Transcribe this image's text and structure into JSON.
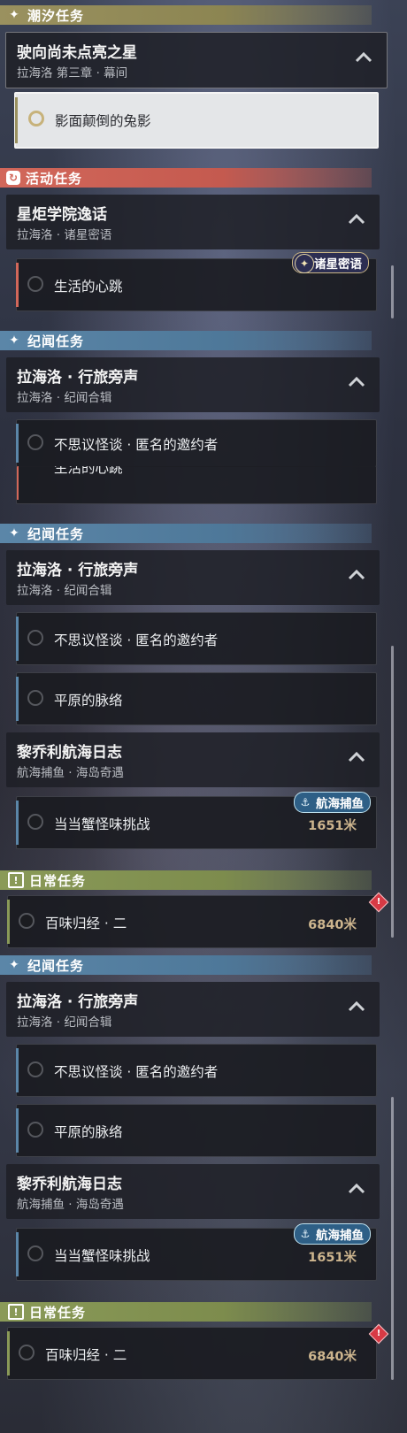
{
  "panel1": {
    "header": {
      "title": "潮汐任务",
      "icon": "sparkle-icon",
      "color": "#9a915f"
    },
    "group": {
      "title": "驶向尚未点亮之星",
      "sub": "拉海洛 第三章 · 幕间"
    },
    "task": {
      "name": "影面颠倒的兔影"
    }
  },
  "panel2": {
    "header": {
      "title": "活动任务",
      "icon": "event-icon",
      "color": "#d2675a"
    },
    "group": {
      "title": "星炬学院逸话",
      "sub": "拉海洛 · 诸星密语"
    },
    "badge": "诸星密语",
    "task": {
      "name": "生活的心跳"
    }
  },
  "panel3": {
    "header": {
      "title": "纪闻任务",
      "icon": "sparkle-icon",
      "color": "#5b86a8"
    },
    "group": {
      "title": "拉海洛 · 行旅旁声",
      "sub": "拉海洛 · 纪闻合辑"
    },
    "task": {
      "name": "不思议怪谈 · 匿名的邀约者"
    },
    "partial_task": "生活的心跳"
  },
  "panel4": {
    "header": {
      "title": "纪闻任务",
      "icon": "sparkle-icon",
      "color": "#5b86a8"
    },
    "group1": {
      "title": "拉海洛 · 行旅旁声",
      "sub": "拉海洛 · 纪闻合辑"
    },
    "task1": {
      "name": "不思议怪谈 · 匿名的邀约者"
    },
    "task2": {
      "name": "平原的脉络"
    },
    "group2": {
      "title": "黎乔利航海日志",
      "sub": "航海捕鱼 · 海岛奇遇"
    },
    "badge": "航海捕鱼",
    "task3": {
      "name": "当当蟹怪味挑战",
      "distance": "1651米"
    },
    "daily_header": {
      "title": "日常任务",
      "icon": "exclamation-icon",
      "color": "#8a9a58"
    },
    "daily": {
      "name": "百味归经 · 二",
      "distance": "6840米",
      "alert": "!"
    }
  },
  "panel5": {
    "header": {
      "title": "纪闻任务",
      "icon": "sparkle-icon",
      "color": "#5b86a8"
    },
    "group1": {
      "title": "拉海洛 · 行旅旁声",
      "sub": "拉海洛 · 纪闻合辑"
    },
    "task1": {
      "name": "不思议怪谈 · 匿名的邀约者"
    },
    "task2": {
      "name": "平原的脉络"
    },
    "group2": {
      "title": "黎乔利航海日志",
      "sub": "航海捕鱼 · 海岛奇遇"
    },
    "badge": "航海捕鱼",
    "task3": {
      "name": "当当蟹怪味挑战",
      "distance": "1651米"
    },
    "daily_header": {
      "title": "日常任务",
      "icon": "exclamation-icon",
      "color": "#8a9a58"
    },
    "daily": {
      "name": "百味归经 · 二",
      "distance": "6840米",
      "alert": "!"
    }
  },
  "icons": {
    "sparkle": "✦",
    "event": "↻",
    "exclamation": "!"
  }
}
